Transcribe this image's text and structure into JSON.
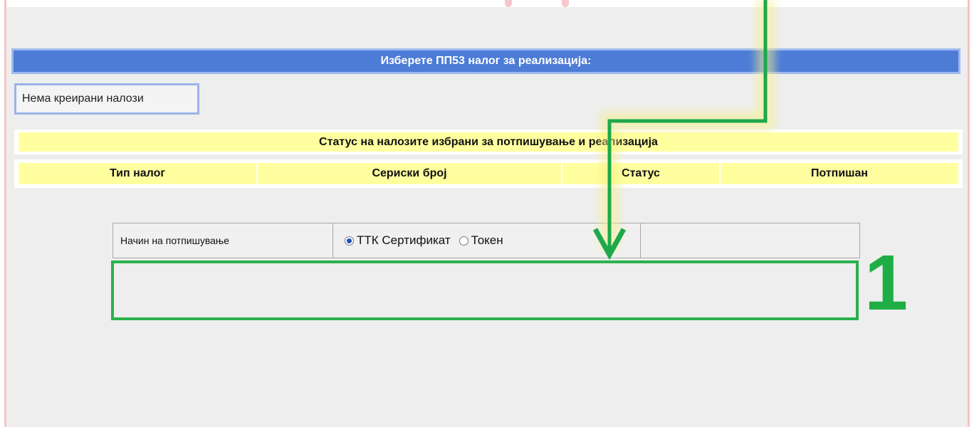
{
  "header": {
    "title": "Изберете ПП53 налог за реализација:"
  },
  "orders": {
    "empty_text": "Нема креирани налози"
  },
  "status": {
    "title": "Статус на налозите избрани за потпишување и реализација",
    "columns": [
      "Тип налог",
      "Сериски број",
      "Статус",
      "Потпишан"
    ]
  },
  "signing": {
    "label": "Начин на потпишување",
    "options": [
      {
        "label": "ТТК Сертификат",
        "selected": true
      },
      {
        "label": "Токен",
        "selected": false
      }
    ]
  },
  "annotation": {
    "step_number": "1",
    "color": "#1fae46"
  }
}
